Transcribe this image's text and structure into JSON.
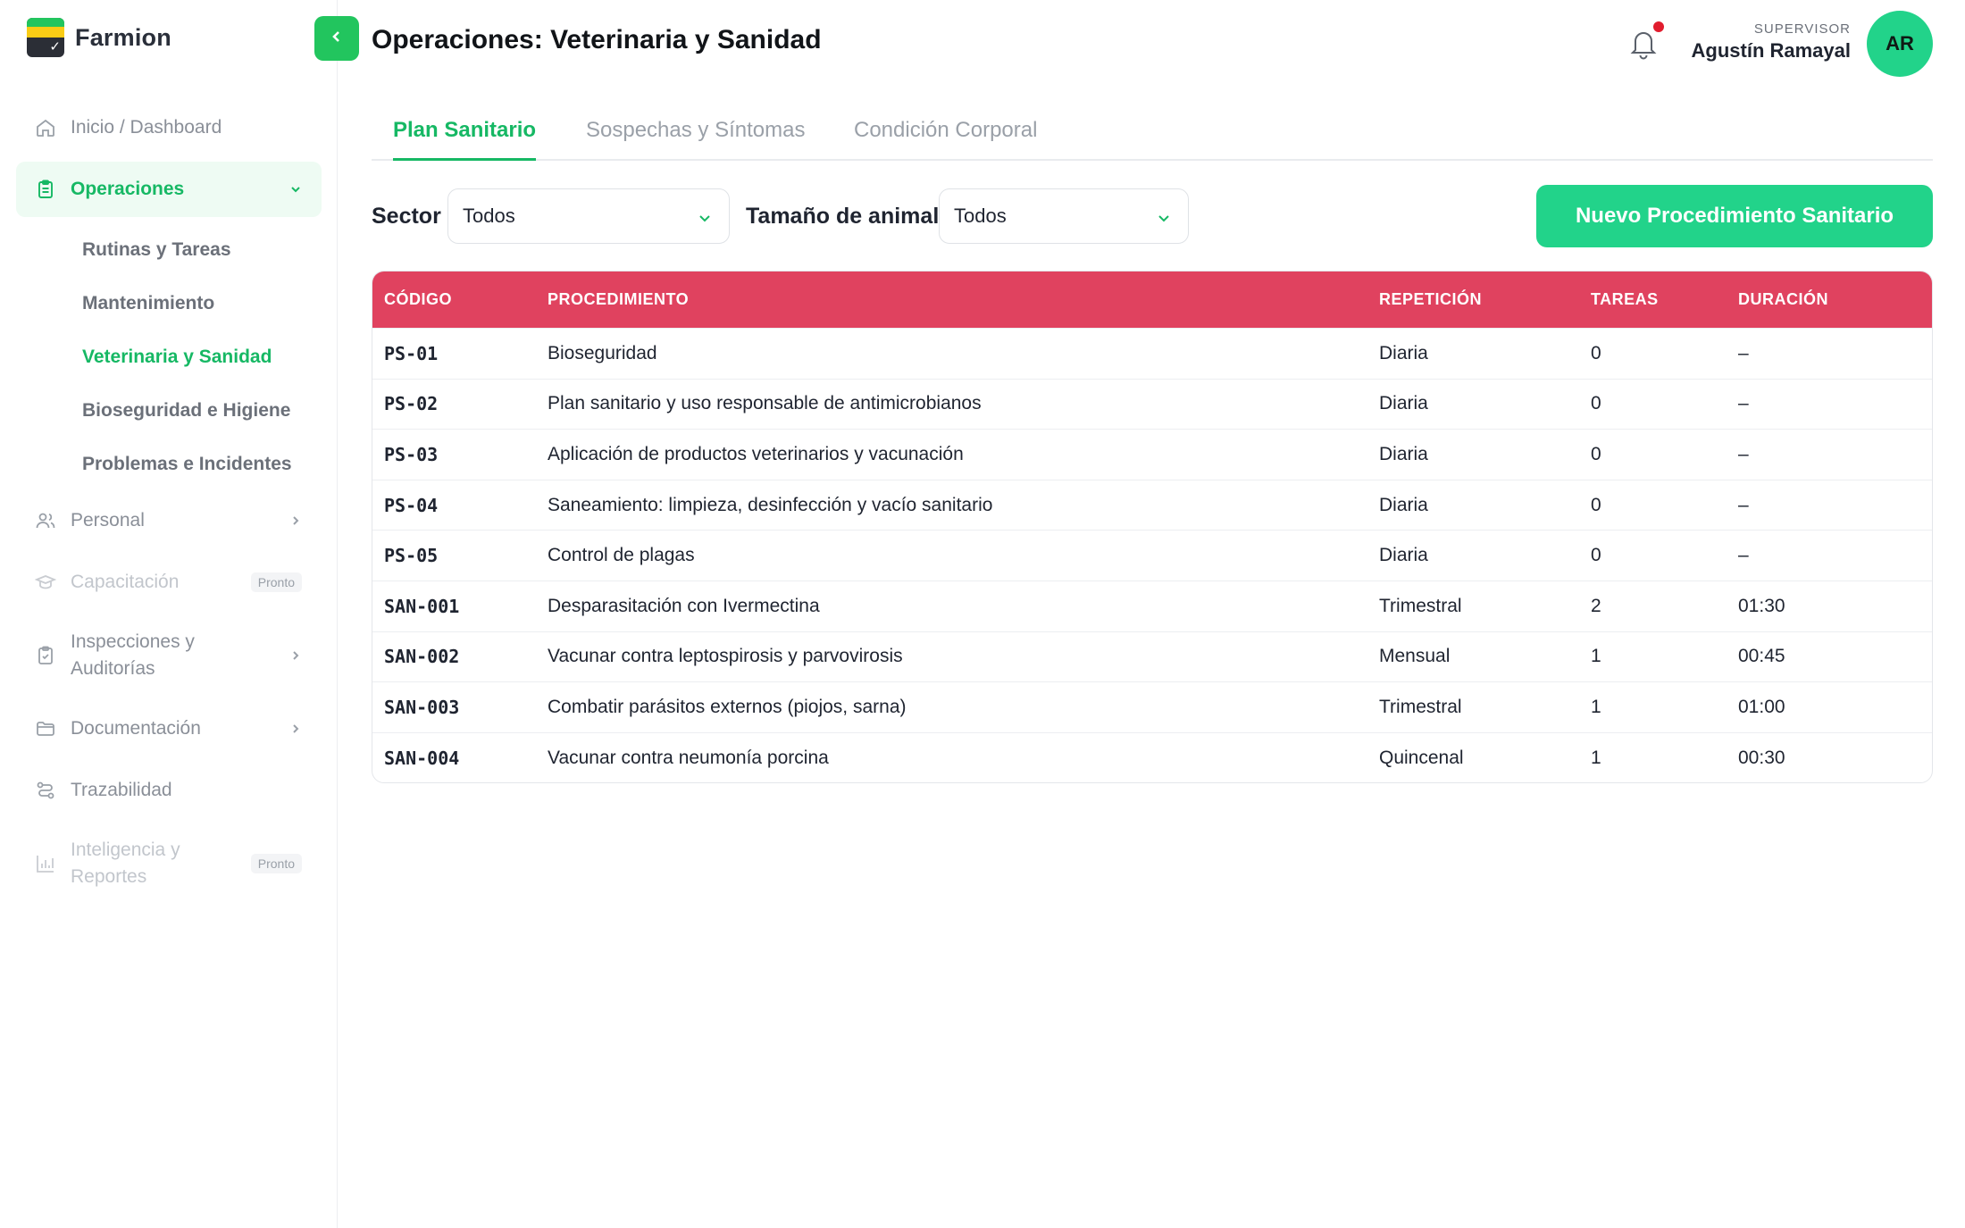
{
  "brand": {
    "name": "Farmion"
  },
  "sidebar": {
    "items": [
      {
        "label": "Inicio / Dashboard",
        "icon": "home-icon"
      },
      {
        "label": "Operaciones",
        "icon": "clipboard-icon",
        "active": true
      },
      {
        "label": "Personal",
        "icon": "users-icon"
      },
      {
        "label": "Capacitación",
        "icon": "graduation-cap-icon",
        "badge": "Pronto",
        "disabled": true
      },
      {
        "label": "Inspecciones y Auditorías",
        "icon": "clipboard-check-icon"
      },
      {
        "label": "Documentación",
        "icon": "folder-icon"
      },
      {
        "label": "Trazabilidad",
        "icon": "route-icon"
      },
      {
        "label": "Inteligencia y Reportes",
        "icon": "bar-chart-icon",
        "badge": "Pronto",
        "disabled": true
      }
    ],
    "sub_items": [
      {
        "label": "Rutinas y Tareas"
      },
      {
        "label": "Mantenimiento"
      },
      {
        "label": "Veterinaria y Sanidad",
        "active": true
      },
      {
        "label": "Bioseguridad e Higiene"
      },
      {
        "label": "Problemas e Incidentes"
      }
    ]
  },
  "header": {
    "title": "Operaciones: Veterinaria y Sanidad",
    "user_role": "SUPERVISOR",
    "user_name": "Agustín Ramayal",
    "avatar_initials": "AR"
  },
  "tabs": [
    {
      "label": "Plan Sanitario",
      "active": true
    },
    {
      "label": "Sospechas y Síntomas"
    },
    {
      "label": "Condición Corporal"
    }
  ],
  "filters": {
    "sector_label": "Sector",
    "sector_value": "Todos",
    "size_label": "Tamaño de animal",
    "size_value": "Todos"
  },
  "actions": {
    "new_procedure": "Nuevo Procedimiento Sanitario"
  },
  "table": {
    "headers": [
      "CÓDIGO",
      "PROCEDIMIENTO",
      "REPETICIÓN",
      "TAREAS",
      "DURACIÓN"
    ],
    "rows": [
      [
        "PS-01",
        "Bioseguridad",
        "Diaria",
        "0",
        "–"
      ],
      [
        "PS-02",
        "Plan sanitario y uso responsable de antimicrobianos",
        "Diaria",
        "0",
        "–"
      ],
      [
        "PS-03",
        "Aplicación de productos veterinarios y vacunación",
        "Diaria",
        "0",
        "–"
      ],
      [
        "PS-04",
        "Saneamiento: limpieza, desinfección y vacío sanitario",
        "Diaria",
        "0",
        "–"
      ],
      [
        "PS-05",
        "Control de plagas",
        "Diaria",
        "0",
        "–"
      ],
      [
        "SAN-001",
        "Desparasitación con Ivermectina",
        "Trimestral",
        "2",
        "01:30"
      ],
      [
        "SAN-002",
        "Vacunar contra leptospirosis y parvovirosis",
        "Mensual",
        "1",
        "00:45"
      ],
      [
        "SAN-003",
        "Combatir parásitos externos (piojos, sarna)",
        "Trimestral",
        "1",
        "01:00"
      ],
      [
        "SAN-004",
        "Vacunar contra neumonía porcina",
        "Quincenal",
        "1",
        "00:30"
      ]
    ]
  },
  "colors": {
    "accent": "#16b864",
    "button": "#22d38a",
    "table_header": "#e0425f",
    "notification": "#e11d2e"
  }
}
